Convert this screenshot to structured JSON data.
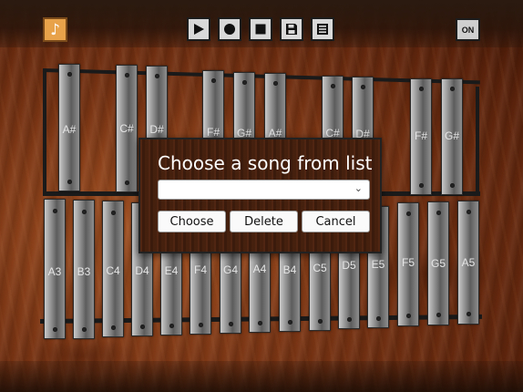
{
  "toolbar": {
    "music_icon": "music-note-icon",
    "play_icon": "play-icon",
    "record_icon": "record-icon",
    "stop_icon": "stop-icon",
    "save_icon": "save-icon",
    "list_icon": "list-icon",
    "on_label": "ON"
  },
  "sharps": [
    "A#",
    "C#",
    "D#",
    "F#",
    "G#",
    "A#",
    "C#",
    "D#",
    "F#",
    "G#"
  ],
  "naturals": [
    "A3",
    "B3",
    "C4",
    "D4",
    "E4",
    "F4",
    "G4",
    "A4",
    "B4",
    "C5",
    "D5",
    "E5",
    "F5",
    "G5",
    "A5"
  ],
  "dialog": {
    "title": "Choose a song from list",
    "select_value": "",
    "choose_label": "Choose",
    "delete_label": "Delete",
    "cancel_label": "Cancel"
  },
  "colors": {
    "accent": "#e8a24a",
    "wood": "#7a3514"
  }
}
